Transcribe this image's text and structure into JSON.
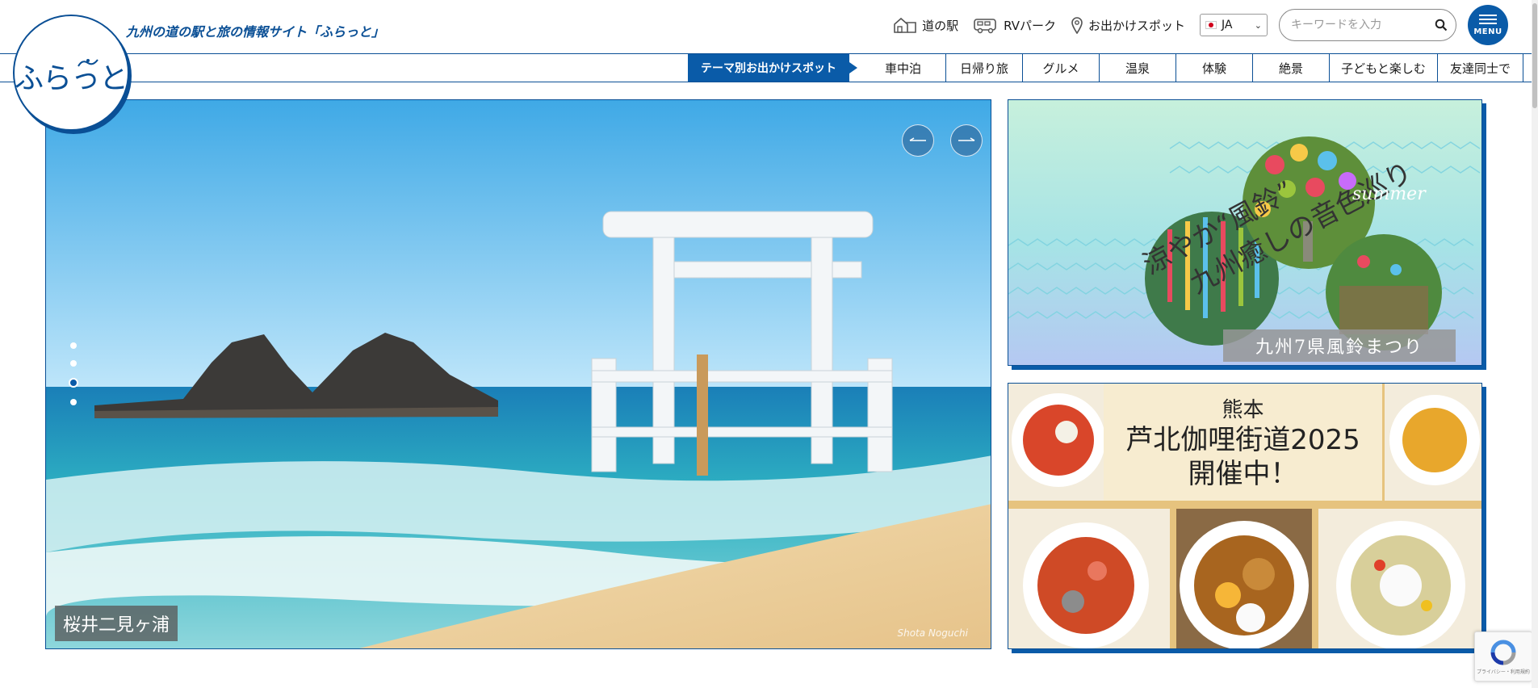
{
  "header": {
    "tagline": "九州の道の駅と旅の情報サイト「ふらっと」",
    "logo_text": "ふらっと",
    "links": [
      {
        "label": "道の駅",
        "icon": "roadside-station-icon"
      },
      {
        "label": "RVパーク",
        "icon": "camper-van-icon"
      },
      {
        "label": "お出かけスポット",
        "icon": "map-pin-icon"
      }
    ],
    "language": "JA",
    "search_placeholder": "キーワードを入力",
    "menu_label": "MENU"
  },
  "categories": {
    "theme_label": "テーマ別お出かけスポット",
    "items": [
      "車中泊",
      "日帰り旅",
      "グルメ",
      "温泉",
      "体験",
      "絶景",
      "子どもと楽しむ",
      "友達同士で"
    ]
  },
  "hero": {
    "caption": "桜井二見ヶ浦",
    "credit": "Shota Noguchi",
    "slide_count": 4,
    "active_slide": 3
  },
  "banners": [
    {
      "title_line1": "涼やか“風鈴”",
      "title_line2": "九州癒しの音色巡り",
      "accent_text": "summer",
      "label": "九州7県風鈴まつり"
    },
    {
      "prefecture": "熊本",
      "title_line1": "芦北伽哩街道2025",
      "title_line2": "開催中！"
    }
  ],
  "recaptcha": {
    "text": "プライバシー・利用規約"
  },
  "colors": {
    "brand": "#0a5ba8",
    "brand_dark": "#0a4f95"
  }
}
